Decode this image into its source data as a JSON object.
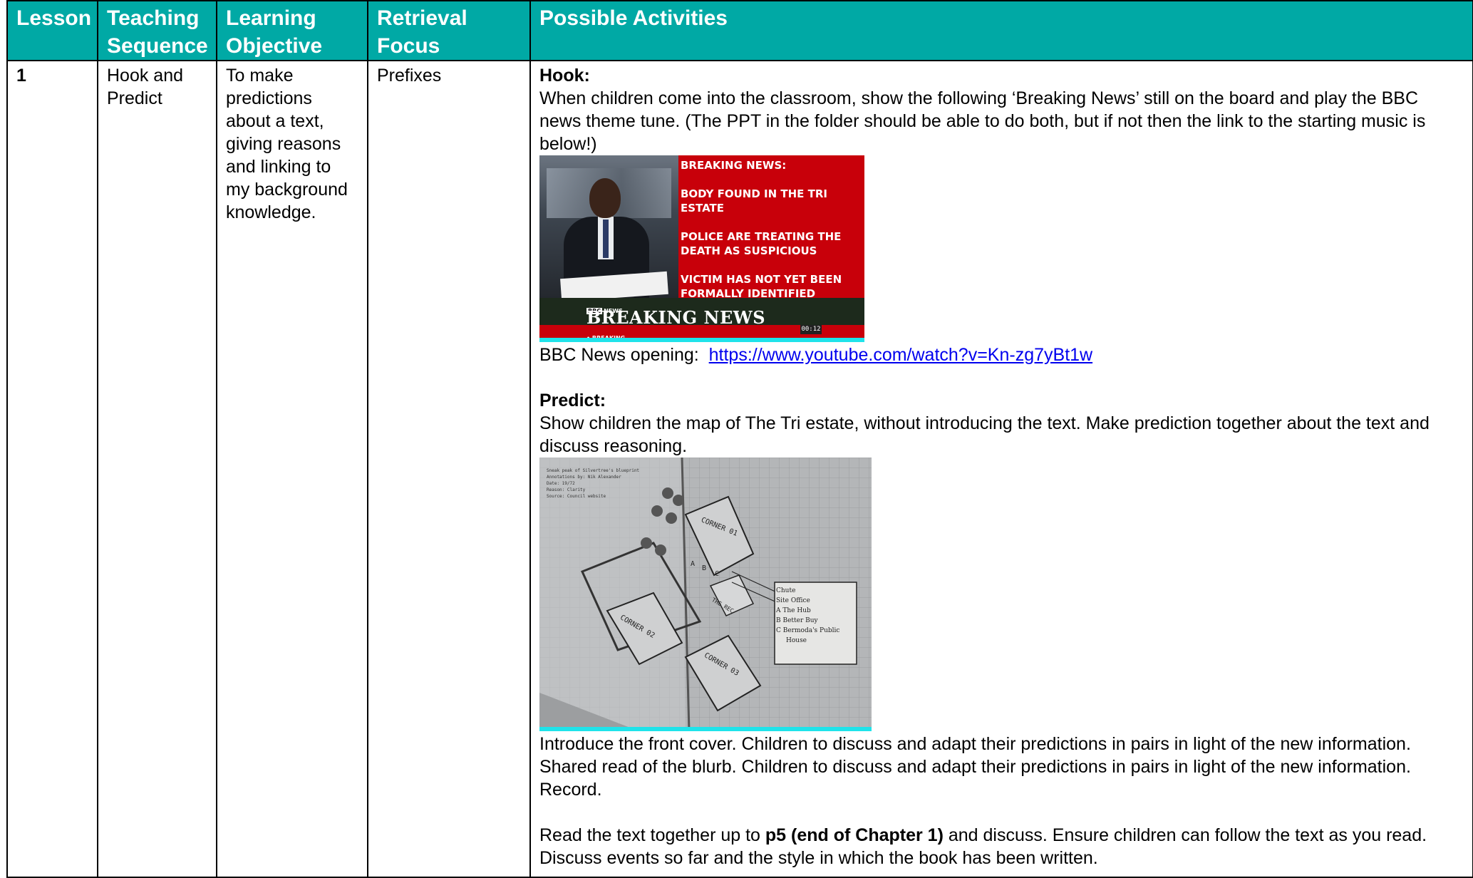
{
  "table": {
    "headers": {
      "lesson": "Lesson",
      "sequence": "Teaching Sequence",
      "objective": "Learning Objective",
      "retrieval": "Retrieval Focus",
      "activities": "Possible Activities"
    },
    "rows": [
      {
        "lesson": "1",
        "sequence": "Hook and Predict",
        "objective": "To make predictions about a text, giving reasons and linking to my background knowledge.",
        "retrieval": "Prefixes"
      }
    ]
  },
  "activities": {
    "hook_heading": "Hook:",
    "hook_text": "When children come into the classroom, show the following ‘Breaking News’ still on the board and play the BBC news theme tune. (The PPT in the folder should be able to do both, but if not then the link to the starting music is below!)",
    "news_image": {
      "headlines": [
        "BREAKING NEWS:",
        "BODY FOUND IN THE TRI ESTATE",
        "POLICE ARE TREATING THE DEATH AS SUSPICIOUS",
        "VICTIM HAS NOT YET BEEN FORMALLY IDENTIFIED"
      ],
      "bbc_label": "BBC",
      "news_label": "NEWS",
      "banner": "BREAKING NEWS",
      "ticker": "• BREAKING",
      "clock": "00:12"
    },
    "link_prefix": "BBC News opening:",
    "link_url": "https://www.youtube.com/watch?v=Kn-zg7yBt1w",
    "predict_heading": "Predict:",
    "predict_text": "Show children the map of The Tri estate, without introducing the text. Make prediction together about the text and discuss reasoning.",
    "map_image": {
      "info_lines": [
        "Sneak peak of Silvertree's blueprint",
        "Annotations by: Nik Alexander",
        "Date: 19/72",
        "Reason: Clarity",
        "Source: Council website"
      ],
      "labels": [
        "CORNER 01",
        "CORNER 02",
        "CORNER 03",
        "THE REC",
        "A",
        "B",
        "C"
      ],
      "legend": [
        "Chute",
        "Site Office",
        "A  The Hub",
        "B  Better Buy",
        "C  Bermoda's Public",
        "House"
      ]
    },
    "intro_text": "Introduce the front cover. Children to discuss and adapt their predictions in pairs in light of the new information. Shared read of the blurb. Children to discuss and adapt their predictions in pairs in light of the new information. Record.",
    "read_prefix": "Read the text together up to",
    "read_bold": "p5 (end of Chapter 1)",
    "read_suffix": "and discuss. Ensure children can follow the text as you read. Discuss events so far and the style in which the book has been written."
  }
}
